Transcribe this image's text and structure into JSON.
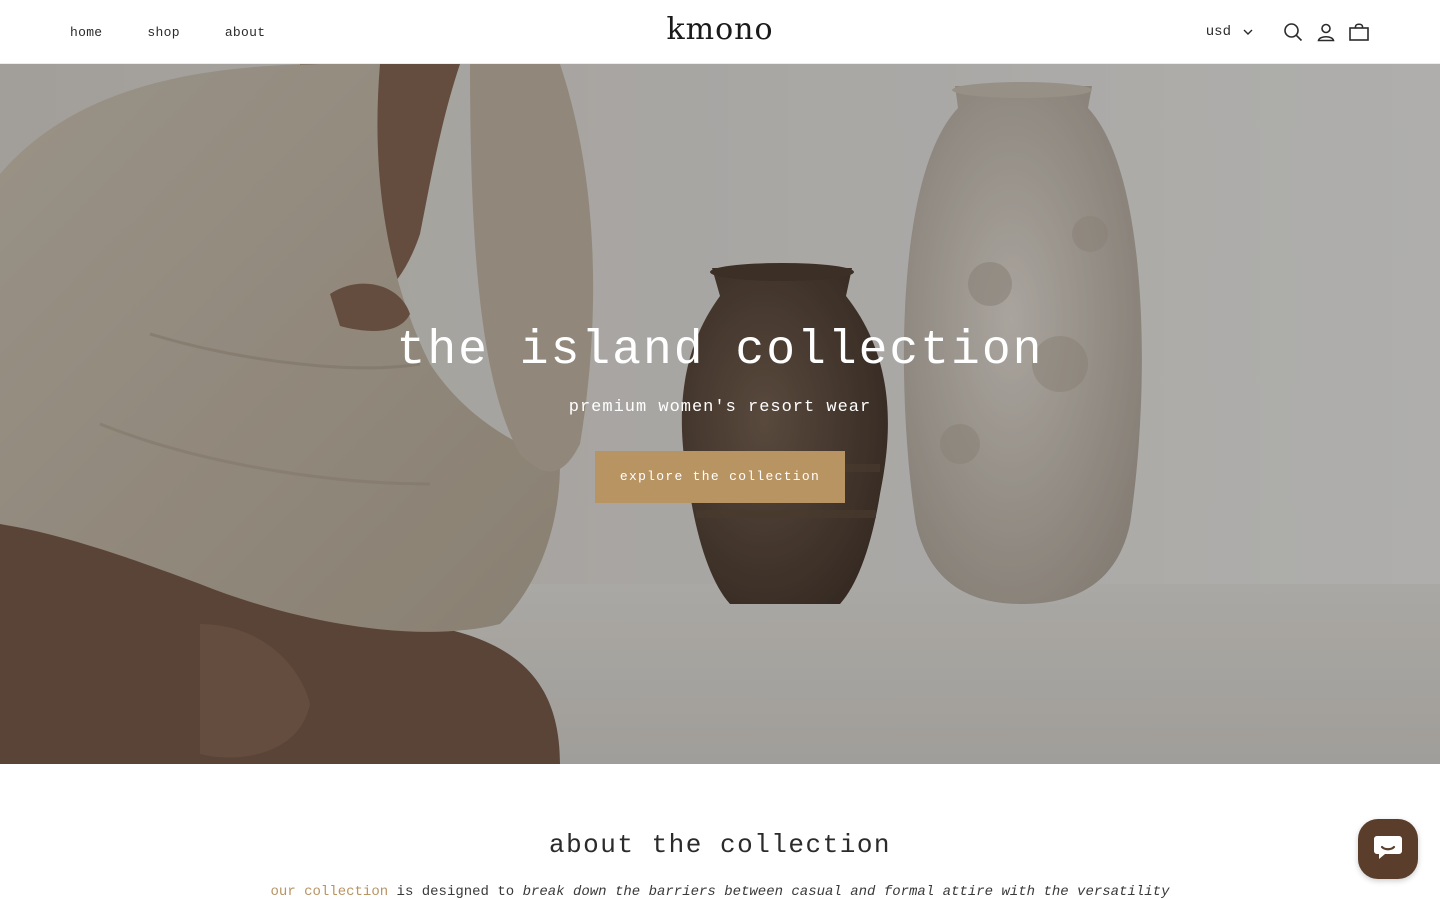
{
  "header": {
    "nav": [
      {
        "label": "home"
      },
      {
        "label": "shop"
      },
      {
        "label": "about"
      }
    ],
    "logo": "kmono",
    "currency": "usd",
    "icons": [
      "chevron-down-icon",
      "search-icon",
      "account-icon",
      "cart-icon"
    ]
  },
  "hero": {
    "title": "the island collection",
    "subtitle": "premium women's resort wear",
    "cta": "explore the collection"
  },
  "about": {
    "title": "about the collection",
    "text_link": "our collection",
    "text_mid": " is designed to ",
    "text_italic": "break down the barriers between casual and formal attire with the versatility"
  },
  "chat": {
    "icon": "chat-icon"
  },
  "colors": {
    "accent": "#b99463",
    "chat": "#5a3d2b",
    "text": "#2b2b2b"
  }
}
